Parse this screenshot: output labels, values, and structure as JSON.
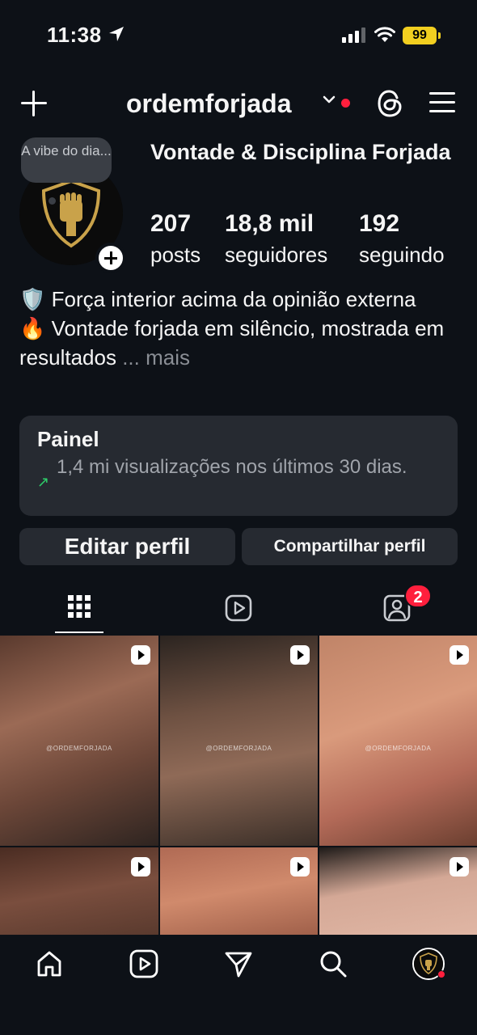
{
  "status": {
    "time": "11:38",
    "battery": "99"
  },
  "header": {
    "username": "ordemforjada"
  },
  "note": {
    "text": "A vibe do dia..."
  },
  "profile": {
    "display_name": "Vontade & Disciplina Forjada",
    "stats": [
      {
        "value": "207",
        "label": "posts"
      },
      {
        "value": "18,8 mil",
        "label": "seguidores"
      },
      {
        "value": "192",
        "label": "seguindo"
      }
    ],
    "bio_line1": "🛡️ Força interior acima da opinião externa",
    "bio_line2": "🔥 Vontade forjada em silêncio, mostrada em resultados",
    "bio_more": "... mais"
  },
  "panel": {
    "title": "Painel",
    "subtitle": "1,4 mi visualizações nos últimos 30 dias."
  },
  "buttons": {
    "edit": "Editar perfil",
    "share": "Compartilhar perfil"
  },
  "tabs": {
    "tagged_badge": "2"
  },
  "grid": {
    "watermark": "@ORDEMFORJADA"
  },
  "icons": {
    "tabs": [
      "grid-icon",
      "reels-icon",
      "tagged-icon"
    ],
    "nav": [
      "home-icon",
      "reels-icon",
      "send-icon",
      "search-icon",
      "profile-avatar"
    ]
  },
  "colors": {
    "background": "#0d1117",
    "card": "#262a31",
    "accent_red": "#ff1f3d",
    "battery": "#f2cf20",
    "gold": "#c9a24a"
  }
}
